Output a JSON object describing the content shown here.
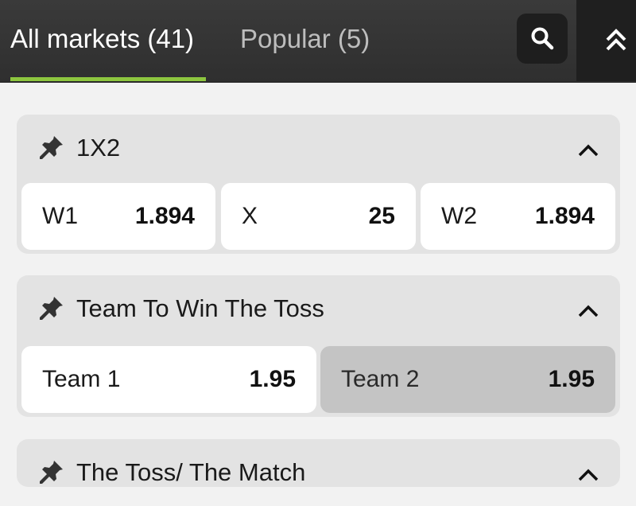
{
  "tabs": [
    {
      "label": "All markets (41)"
    },
    {
      "label": "Popular (5)"
    }
  ],
  "markets": [
    {
      "title": "1X2",
      "odds": [
        {
          "label": "W1",
          "value": "1.894"
        },
        {
          "label": "X",
          "value": "25"
        },
        {
          "label": "W2",
          "value": "1.894"
        }
      ]
    },
    {
      "title": "Team To Win The Toss",
      "odds": [
        {
          "label": "Team 1",
          "value": "1.95"
        },
        {
          "label": "Team 2",
          "value": "1.95",
          "selected": true
        }
      ]
    },
    {
      "title": "The Toss/ The Match"
    }
  ],
  "colors": {
    "accent": "#8dc63f",
    "header_bg": "#333333",
    "card_bg": "#e3e3e3",
    "selected_odd_bg": "#c4c4c4"
  },
  "icons": {
    "search": "search-icon",
    "collapse_all": "double-chevron-up-icon",
    "pin": "pin-icon",
    "collapse": "chevron-up-icon"
  }
}
